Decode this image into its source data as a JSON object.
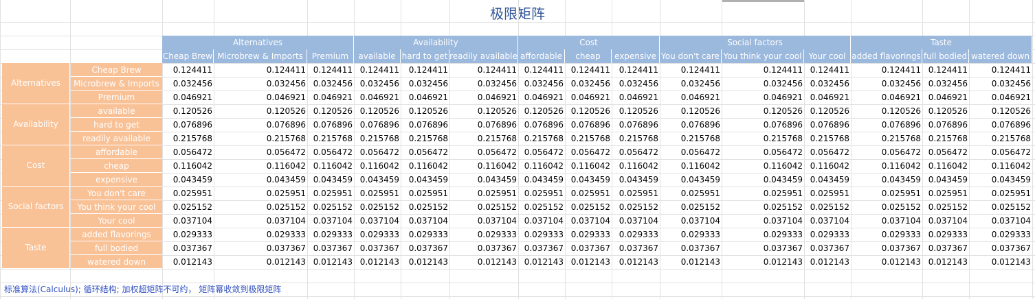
{
  "title": "极限矩阵",
  "groups": [
    "Alternatives",
    "Availability",
    "Cost",
    "Social factors",
    "Taste"
  ],
  "columns": [
    "Cheap Brew",
    "Microbrew & Imports",
    "Premium",
    "available",
    "hard to get",
    "readily available",
    "affordable",
    "cheap",
    "expensive",
    "You don't care",
    "You think your cool",
    "Your cool",
    "added flavorings",
    "full bodied",
    "watered down"
  ],
  "rows": [
    {
      "label": "Cheap Brew",
      "value": "0.124411"
    },
    {
      "label": "Microbrew & Imports",
      "value": "0.032456"
    },
    {
      "label": "Premium",
      "value": "0.046921"
    },
    {
      "label": "available",
      "value": "0.120526"
    },
    {
      "label": "hard to get",
      "value": "0.076896"
    },
    {
      "label": "readily available",
      "value": "0.215768"
    },
    {
      "label": "affordable",
      "value": "0.056472"
    },
    {
      "label": "cheap",
      "value": "0.116042"
    },
    {
      "label": "expensive",
      "value": "0.043459"
    },
    {
      "label": "You don't care",
      "value": "0.025951"
    },
    {
      "label": "You think your cool",
      "value": "0.025152"
    },
    {
      "label": "Your cool",
      "value": "0.037104"
    },
    {
      "label": "added flavorings",
      "value": "0.029333"
    },
    {
      "label": "full bodied",
      "value": "0.037367"
    },
    {
      "label": "watered down",
      "value": "0.012143"
    }
  ],
  "footer": "标准算法(Calculus); 循环结构; 加权超矩阵不可约， 矩阵幂收敛到极限矩阵"
}
